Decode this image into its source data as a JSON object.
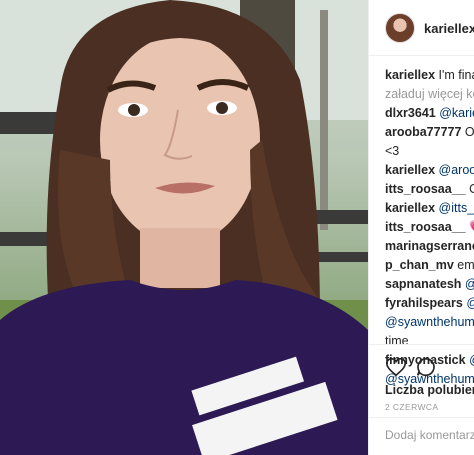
{
  "post": {
    "username": "kariellex"
  },
  "comments": [
    {
      "user": "kariellex",
      "text": "I'm finall",
      "mention": ""
    },
    {
      "type": "load-more",
      "text": "załaduj więcej kom"
    },
    {
      "user": "dlxr3641",
      "mention": "@kariell",
      "text": ""
    },
    {
      "user": "arooba77777",
      "text": "Oh",
      "mention": ""
    },
    {
      "type": "continuation",
      "text": "<3"
    },
    {
      "user": "kariellex",
      "mention": "@arooba",
      "text": ""
    },
    {
      "user": "itts_roosaa__",
      "text": "Ohh",
      "mention": ""
    },
    {
      "user": "kariellex",
      "mention": "@itts_ro",
      "text": ""
    },
    {
      "user": "itts_roosaa__",
      "text": "💗💗",
      "mention": "",
      "hearts": true
    },
    {
      "user": "marinagserrano",
      "mention": "@",
      "text": ""
    },
    {
      "user": "p_chan_mv",
      "text": "emma",
      "mention": ""
    },
    {
      "user": "sapnanatesh",
      "mention": "@ne",
      "text": ""
    },
    {
      "user": "fyrahilspears",
      "mention": "@fi",
      "text": ""
    },
    {
      "type": "mention-line",
      "mention": "@syawnthehuman"
    },
    {
      "type": "continuation",
      "text": "time"
    },
    {
      "user": "finnyonastick",
      "mention": "@fy",
      "text": ""
    },
    {
      "type": "mention-line",
      "mention": "@syawnthehuma"
    }
  ],
  "actions": {
    "likes_label": "Liczba polubień",
    "date": "2 CZERWCA",
    "add_comment_placeholder": "Dodaj komentarz..."
  },
  "icons": {
    "like": "heart-outline-icon",
    "comment": "speech-bubble-icon"
  },
  "colors": {
    "mention": "#003569",
    "muted": "#999999",
    "shirt": "#2d1a55"
  }
}
